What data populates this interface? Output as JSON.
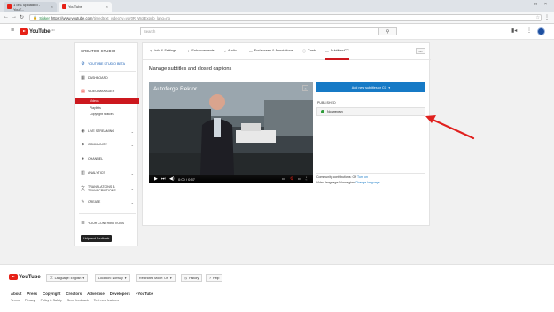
{
  "browser": {
    "tabs": [
      {
        "title": "1 of 1 uploaded - YouT...",
        "active": false
      },
      {
        "title": "YouTube",
        "active": true
      }
    ],
    "address": {
      "secure_label": "Sikker",
      "url_host": "https://www.youtube.com",
      "url_path": "/timedtext_video?v=yqr0R_WqfExpub_lang=no"
    }
  },
  "header": {
    "logo_text": "YouTube",
    "logo_region": "NO",
    "search_placeholder": "Search"
  },
  "sidebar": {
    "title": "CREATOR STUDIO",
    "beta_item": "YOUTUBE STUDIO BETA",
    "dashboard": "DASHBOARD",
    "video_manager": "VIDEO MANAGER",
    "sub_items": [
      "Videos",
      "Playlists",
      "Copyright Notices"
    ],
    "items": [
      "LIVE STREAMING",
      "COMMUNITY",
      "CHANNEL",
      "ANALYTICS",
      "TRANSLATIONS & TRANSCRIPTIONS",
      "CREATE"
    ],
    "your_contributions": "YOUR CONTRIBUTIONS",
    "help_button": "Help and feedback"
  },
  "editor_tabs": [
    "Info & Settings",
    "Enhancements",
    "Audio",
    "End screen & Annotations",
    "Cards",
    "Subtitles/CC"
  ],
  "main": {
    "title": "Manage subtitles and closed captions",
    "video_title": "Autoferge Rektor",
    "time": "0:00 / 0:57",
    "progress": 0,
    "add_button": "Add new subtitles or CC",
    "published_label": "PUBLISHED",
    "language": "Norwegian",
    "community_label": "Community contributions: Off",
    "community_link": "Turn on",
    "video_lang_label": "Video language: Norwegian",
    "video_lang_link": "Change language"
  },
  "footer": {
    "logo_text": "YouTube",
    "language_btn": "Language: English",
    "location_btn": "Location: Norway",
    "restricted_btn": "Restricted Mode: Off",
    "history_btn": "History",
    "help_btn": "Help",
    "links_primary": [
      "About",
      "Press",
      "Copyright",
      "Creators",
      "Advertise",
      "Developers",
      "+YouTube"
    ],
    "links_secondary": [
      "Terms",
      "Privacy",
      "Policy & Safety",
      "Send feedback",
      "Test new features"
    ]
  },
  "colors": {
    "brand_red": "#e62117",
    "accent_blue": "#167ac6",
    "annotation_arrow": "#e0201e"
  }
}
